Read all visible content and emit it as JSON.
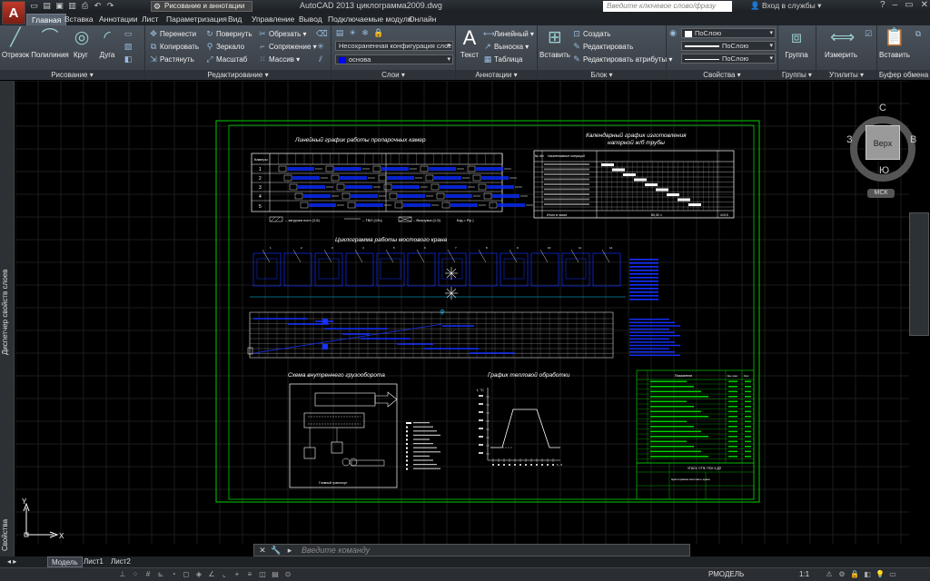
{
  "app": {
    "logo_letter": "A",
    "workspace": "Рисование и аннотации",
    "window_title": "AutoCAD 2013    циклограмма2009.dwg",
    "search_placeholder": "Введите ключевое слово/фразу",
    "signin": "Вход в службы"
  },
  "ribbon_tabs": [
    "Главная",
    "Вставка",
    "Аннотации",
    "Лист",
    "Параметризация",
    "Вид",
    "Управление",
    "Вывод",
    "Подключаемые модули",
    "Онлайн"
  ],
  "panels": {
    "draw": {
      "title": "Рисование",
      "buttons": [
        "Отрезок",
        "Полилиния",
        "Круг",
        "Дуга"
      ]
    },
    "modify": {
      "title": "Редактирование",
      "items": [
        "Перенести",
        "Повернуть",
        "Обрезать",
        "Копировать",
        "Зеркало",
        "Сопряжение",
        "Растянуть",
        "Масштаб",
        "Массив"
      ]
    },
    "layers": {
      "title": "Слои",
      "state": "Несохраненная конфигурация слоев",
      "current": "основа"
    },
    "annotation": {
      "title": "Аннотации",
      "text_button": "Текст",
      "items": [
        "Линейный",
        "Выноска",
        "Таблица"
      ]
    },
    "block": {
      "title": "Блок",
      "insert": "Вставить",
      "items": [
        "Создать",
        "Редактировать",
        "Редактировать атрибуты"
      ]
    },
    "properties": {
      "title": "Свойства",
      "color": "ПоСлою",
      "lineweight": "ПоСлою",
      "linetype": "ПоСлою"
    },
    "groups": {
      "title": "Группы",
      "button": "Группа"
    },
    "utilities": {
      "title": "Утилиты",
      "button": "Измерить"
    },
    "clipboard": {
      "title": "Буфер обмена",
      "button": "Вставить"
    }
  },
  "palettes": {
    "left_top": "Диспетчер свойств слоев",
    "left_bottom": "Свойства"
  },
  "viewcube": {
    "face": "Верх",
    "north": "С",
    "south": "Ю",
    "east": "В",
    "west": "З",
    "ucs": "МСК"
  },
  "drawing": {
    "title1": "Линейный график работы пропарочных камер",
    "title2": "Календарный график изготовления",
    "title2b": "напорной ж/б трубы",
    "title3": "Циклограмма работы мостового крана",
    "title4": "Схема внутреннего грузооборота",
    "title5": "График тепловой обработки",
    "table1_header": "Камеры",
    "table1_rows": [
      "1",
      "2",
      "3",
      "4",
      "5"
    ],
    "legend1": "– загрузка пост (2-6)",
    "legend2": "– ТВО (13ч)",
    "legend3": "– Выгрузка (1-5)",
    "legend4": "Кзд = Rр )",
    "table2_col1": "№ п/п",
    "table2_col2": "Наименование операций",
    "table2_total": "Итого в часах",
    "table2_sum": "80,30 ч",
    "table2_total_value": "419,5",
    "heat_axis_y": "t, °C",
    "heat_axis_x": "τ, ч",
    "stamp_title": "УГАСУ, СТФ, ПСК 4 ДП",
    "stamp_name": "Циклограмма мостового крана",
    "spec_col": "Показатели",
    "spec_col2": "Ед. изм.",
    "spec_col3": "Кол.",
    "scheme_label": "Главный транспорт"
  },
  "command": {
    "placeholder": "Введите команду"
  },
  "layouts": [
    "Модель",
    "Лист1",
    "Лист2"
  ],
  "status": {
    "coords": "",
    "mode": "РМОДЕЛЬ",
    "scale": "1:1"
  }
}
